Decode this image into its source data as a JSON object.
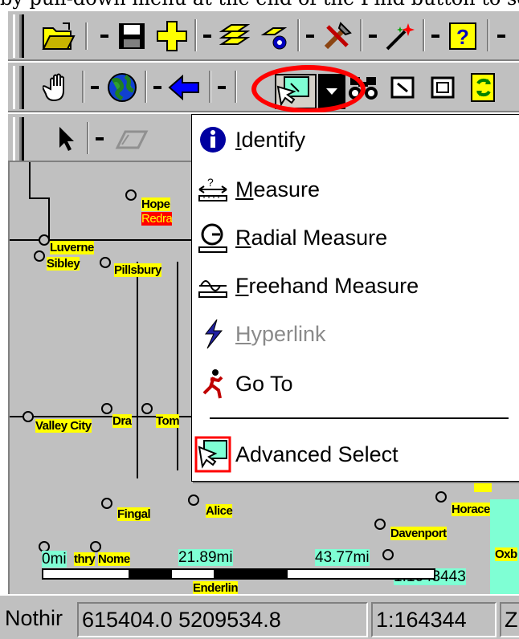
{
  "caption": "by pull-down menu at the end of the Find button to select",
  "toolbar1": {
    "buttons": [
      "open-folder-icon",
      "save-icon",
      "add-data-icon",
      "layers-icon",
      "layer-properties-icon",
      "tools-icon",
      "wizard-icon",
      "help-icon"
    ]
  },
  "toolbar2": {
    "buttons": [
      "pan-hand-icon",
      "globe-icon",
      "back-arrow-icon",
      "select-icon",
      "find-binoculars-icon",
      "zoom-extent-icon",
      "refresh-icon"
    ]
  },
  "toolbar3": {
    "buttons": [
      "pointer-icon",
      "edit-shape-icon"
    ]
  },
  "menu": {
    "items": [
      {
        "label": "Identify",
        "mnemonic": "I",
        "icon": "info-icon",
        "enabled": true
      },
      {
        "label": "Measure",
        "mnemonic": "M",
        "icon": "measure-icon",
        "enabled": true
      },
      {
        "label": "Radial Measure",
        "mnemonic": "R",
        "icon": "radial-measure-icon",
        "enabled": true
      },
      {
        "label": "Freehand Measure",
        "mnemonic": "F",
        "icon": "freehand-measure-icon",
        "enabled": true
      },
      {
        "label": "Hyperlink",
        "mnemonic": "H",
        "icon": "lightning-icon",
        "enabled": false
      },
      {
        "label": "Go To",
        "mnemonic": "",
        "icon": "running-man-icon",
        "enabled": true
      },
      {
        "label": "Advanced Select",
        "mnemonic": "",
        "icon": "advanced-select-icon",
        "enabled": true
      }
    ]
  },
  "map": {
    "cities": [
      "Hope",
      "Redra",
      "Luverne",
      "Sibley",
      "Pillsbury",
      "Valley City",
      "Dra",
      "Tom",
      "Fingal",
      "Alice",
      "Horace",
      "Davenport",
      "Oxb",
      "Nome",
      "Enderlin",
      "thry"
    ],
    "distances": [
      "0mi",
      "21.89mi",
      "43.77mi"
    ],
    "scale_label": "1:1643443"
  },
  "status": {
    "message": "Nothir",
    "coords": "615404.0 5209534.8",
    "scale": "1:164344",
    "extra": "Z"
  },
  "colors": {
    "highlight": "#ff0000",
    "label_bg": "#ffff00",
    "measure_bg": "#7fffd4"
  }
}
